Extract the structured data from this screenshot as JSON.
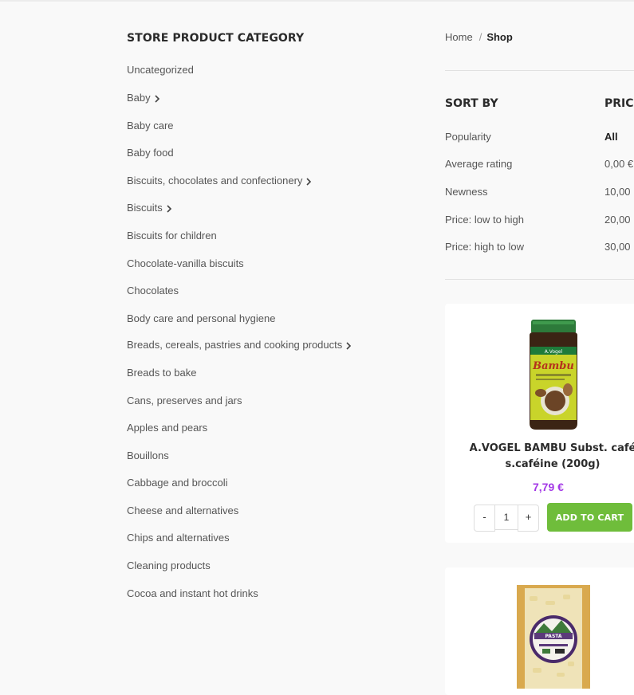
{
  "sidebar": {
    "title": "STORE PRODUCT CATEGORY",
    "categories": [
      {
        "label": "Uncategorized",
        "has_children": false
      },
      {
        "label": "Baby",
        "has_children": true
      },
      {
        "label": "Baby care",
        "has_children": false
      },
      {
        "label": "Baby food",
        "has_children": false
      },
      {
        "label": "Biscuits, chocolates and confectionery",
        "has_children": true
      },
      {
        "label": "Biscuits",
        "has_children": true
      },
      {
        "label": "Biscuits for children",
        "has_children": false
      },
      {
        "label": "Chocolate-vanilla biscuits",
        "has_children": false
      },
      {
        "label": "Chocolates",
        "has_children": false
      },
      {
        "label": "Body care and personal hygiene",
        "has_children": false
      },
      {
        "label": "Breads, cereals, pastries and cooking products",
        "has_children": true
      },
      {
        "label": "Breads to bake",
        "has_children": false
      },
      {
        "label": "Cans, preserves and jars",
        "has_children": false
      },
      {
        "label": "Apples and pears",
        "has_children": false
      },
      {
        "label": "Bouillons",
        "has_children": false
      },
      {
        "label": "Cabbage and broccoli",
        "has_children": false
      },
      {
        "label": "Cheese and alternatives",
        "has_children": false
      },
      {
        "label": "Chips and alternatives",
        "has_children": false
      },
      {
        "label": "Cleaning products",
        "has_children": false
      },
      {
        "label": "Cocoa and instant hot drinks",
        "has_children": false
      }
    ]
  },
  "breadcrumb": {
    "home": "Home",
    "separator": "/",
    "current": "Shop"
  },
  "sort": {
    "title": "SORT BY",
    "options": [
      "Popularity",
      "Average rating",
      "Newness",
      "Price: low to high",
      "Price: high to low"
    ]
  },
  "price_filter": {
    "title": "PRICE",
    "options": [
      "All",
      "0,00 €",
      "10,00",
      "20,00",
      "30,00"
    ]
  },
  "products": [
    {
      "title": "A.VOGEL BAMBU Subst. café s.caféine (200g)",
      "price": "7,79 €",
      "qty_minus": "-",
      "qty_value": "1",
      "qty_plus": "+",
      "add_to_cart": "ADD TO CART"
    },
    {
      "title": "",
      "price": ""
    }
  ],
  "colors": {
    "price_accent": "#a338e6",
    "cart_button": "#6fbd3b"
  }
}
